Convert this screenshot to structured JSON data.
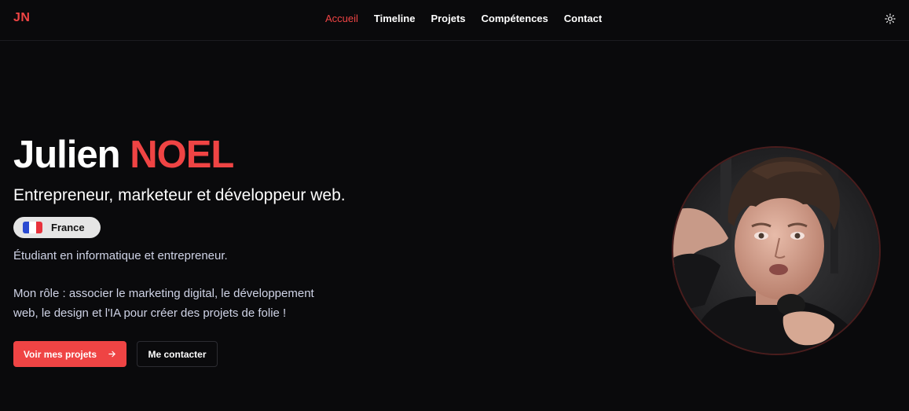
{
  "header": {
    "logo": "JN",
    "nav": [
      {
        "label": "Accueil",
        "active": true
      },
      {
        "label": "Timeline",
        "active": false
      },
      {
        "label": "Projets",
        "active": false
      },
      {
        "label": "Compétences",
        "active": false
      },
      {
        "label": "Contact",
        "active": false
      }
    ],
    "theme_icon": "sun-icon"
  },
  "hero": {
    "first_name": "Julien",
    "last_name": "NOEL",
    "subtitle": "Entrepreneur, marketeur et développeur web.",
    "country": "France",
    "intro": "Étudiant en informatique et entrepreneur.",
    "role_line1": "Mon rôle : associer le marketing digital, le développement",
    "role_line2": "web, le design et l'IA pour créer des projets de folie !",
    "primary_button": "Voir mes projets",
    "secondary_button": "Me contacter",
    "profile_photo": "profile-photo"
  },
  "colors": {
    "accent": "#ef4444",
    "background": "#0a0a0c",
    "text": "#ffffff",
    "muted_text": "#cfd3e6"
  }
}
